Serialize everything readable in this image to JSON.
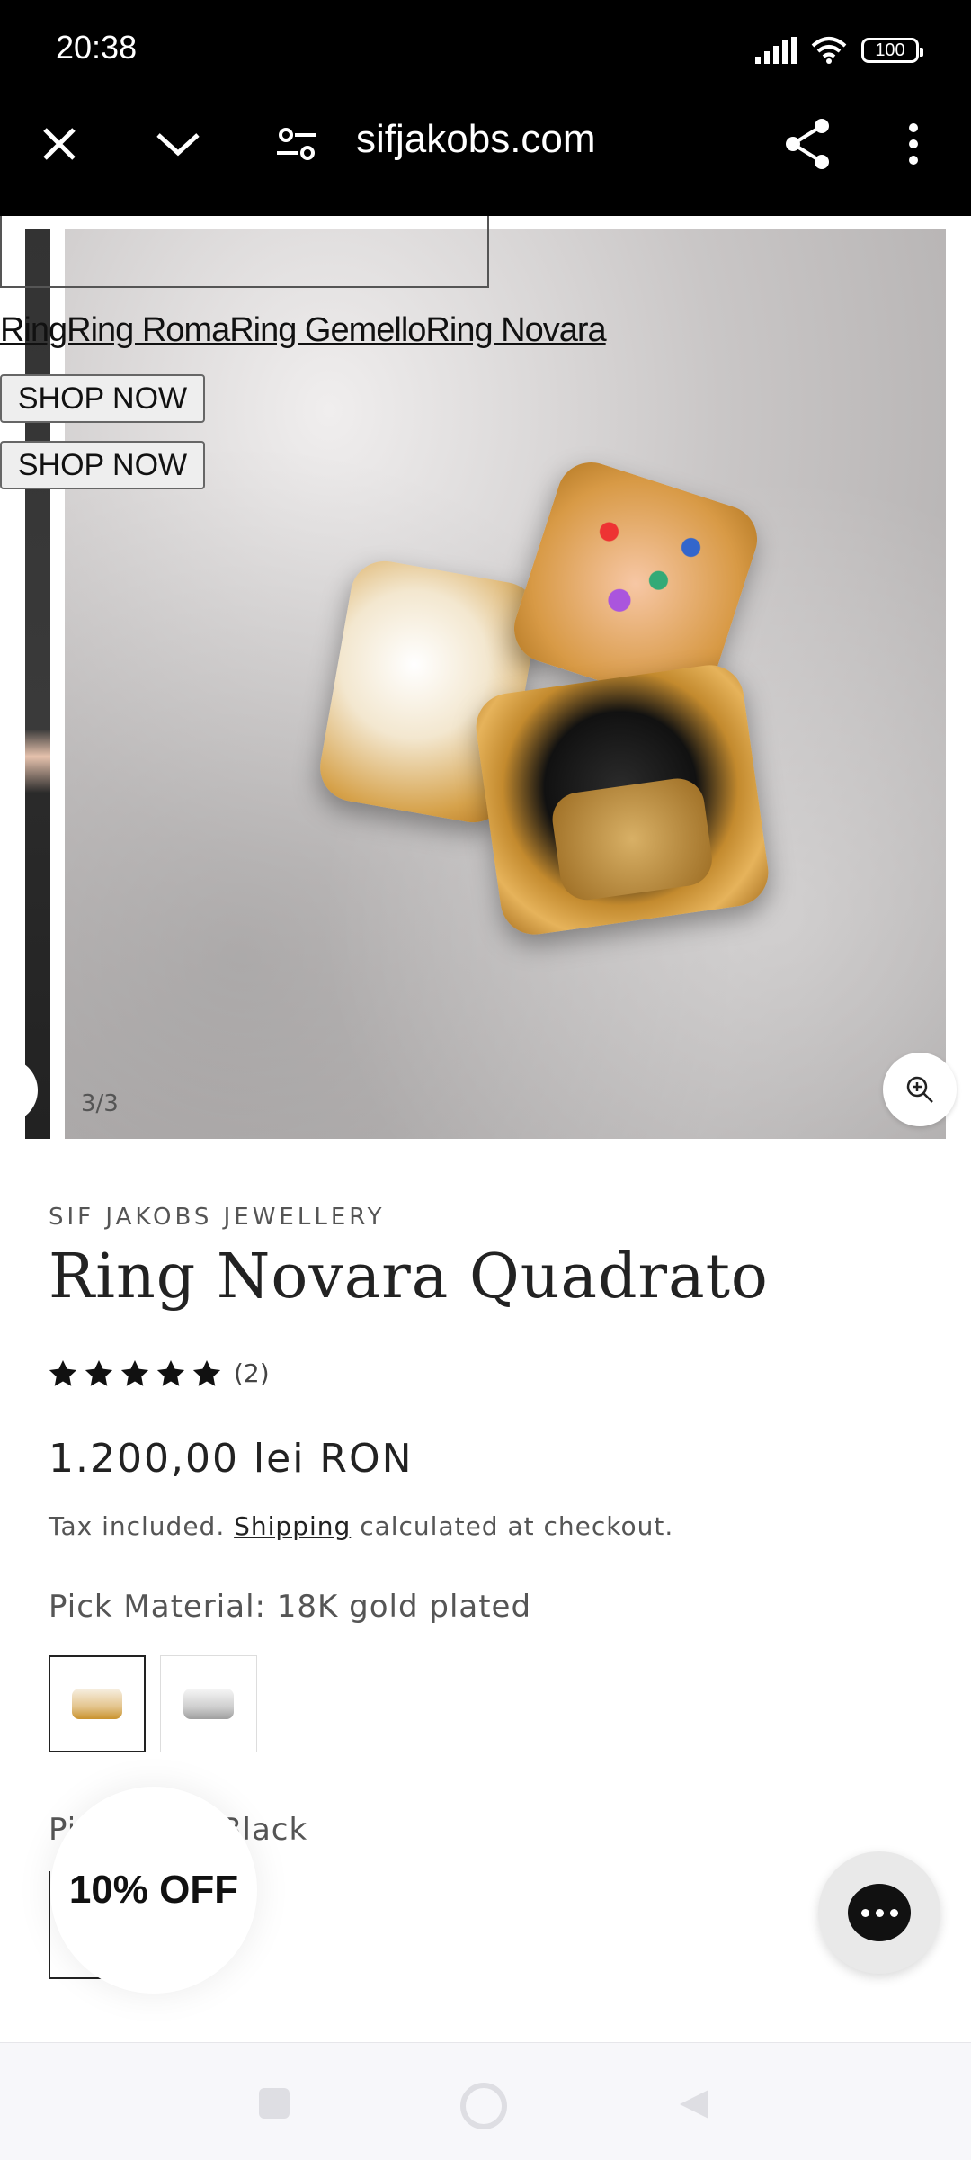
{
  "status_bar": {
    "time": "20:38",
    "battery": "100"
  },
  "browser": {
    "url": "sifjakobs.com"
  },
  "gallery": {
    "overlay_link": "RingRing RomaRing GemelloRing Novara",
    "shop_buttons": [
      "SHOP NOW",
      "SHOP NOW"
    ],
    "slide_counter": "3/3"
  },
  "product": {
    "brand": "SIF JAKOBS JEWELLERY",
    "title": "Ring Novara Quadrato",
    "rating": {
      "stars": 5,
      "count": "(2)"
    },
    "price": "1.200,00 lei RON",
    "tax_prefix": "Tax included.",
    "tax_link": "Shipping",
    "tax_suffix": "calculated at checkout.",
    "material_label": "Pick Material: 18K gold plated",
    "stone_label": "Pi",
    "stone_value": "Black"
  },
  "popup": {
    "discount": "10% OFF"
  },
  "colors": {
    "topbar": "#000000",
    "accent": "#222222"
  }
}
